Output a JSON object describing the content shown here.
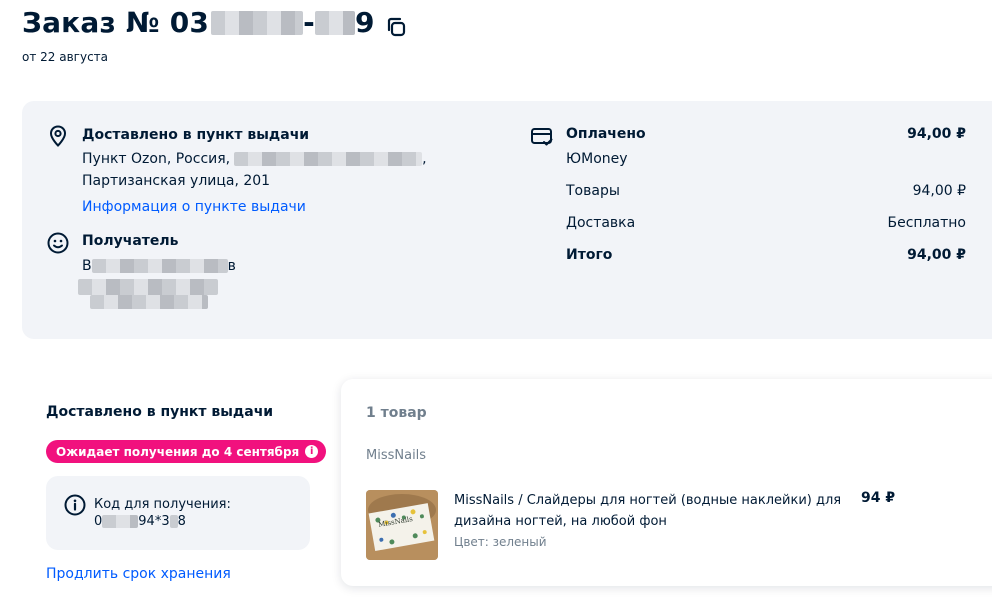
{
  "header": {
    "title_prefix": "Заказ № 03",
    "title_mid": "-",
    "title_suffix": "9",
    "date": "от 22 августа"
  },
  "delivery": {
    "title": "Доставлено в пункт выдачи",
    "address_line1_prefix": "Пункт Ozon, Россия,",
    "address_line1_suffix": ",",
    "address_line2": "Партизанская улица, 201",
    "info_link": "Информация о пункте выдачи"
  },
  "recipient": {
    "title": "Получатель",
    "name_first": "В",
    "name_last": "в"
  },
  "payment": {
    "title": "Оплачено",
    "amount": "94,00 ₽",
    "method": "ЮMoney",
    "rows": [
      {
        "label": "Товары",
        "value": "94,00 ₽"
      },
      {
        "label": "Доставка",
        "value": "Бесплатно"
      }
    ],
    "total_label": "Итого",
    "total_value": "94,00 ₽"
  },
  "status": {
    "title": "Доставлено в пункт выдачи",
    "badge": "Ожидает получения до 4 сентября",
    "code_label": "Код для получения:",
    "code_a": "0",
    "code_b": "94*3",
    "code_c": "8",
    "extend_link": "Продлить срок хранения"
  },
  "product_block": {
    "count": "1 товар",
    "seller": "MissNails",
    "item": {
      "name_line1": "MissNails / Слайдеры для ногтей (водные наклейки) для",
      "name_line2": "дизайна ногтей, на любой фон",
      "color": "Цвет: зеленый",
      "price": "94 ₽",
      "thumb_text": "MissNails"
    }
  },
  "colors": {
    "text": "#001a34",
    "link": "#005bff",
    "badge": "#f1117e",
    "card_bg": "#f2f4f8"
  }
}
